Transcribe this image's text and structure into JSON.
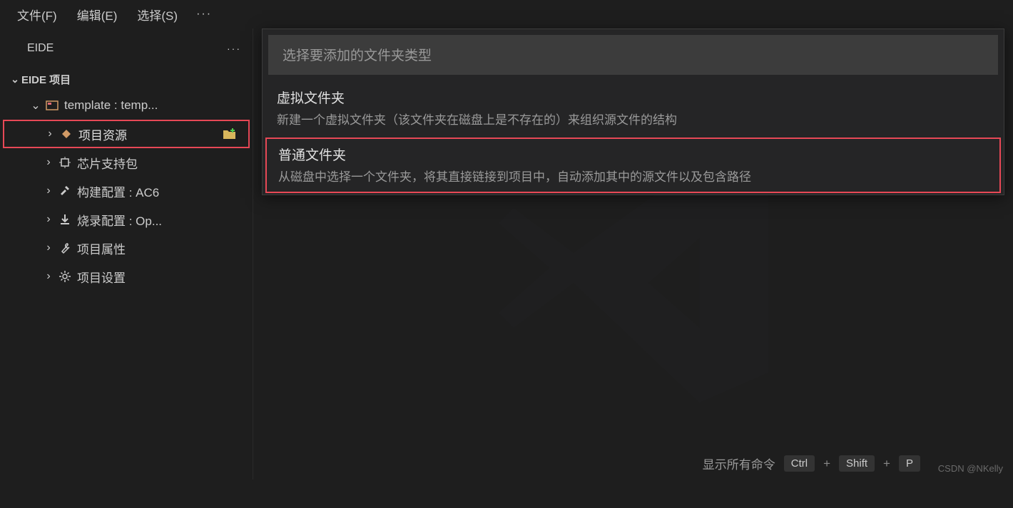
{
  "menubar": {
    "file": "文件(F)",
    "edit": "编辑(E)",
    "select": "选择(S)",
    "more": "···"
  },
  "sidebar": {
    "title": "EIDE",
    "more": "···",
    "section": "EIDE 项目",
    "project_name": "template : temp...",
    "items": [
      {
        "label": "项目资源",
        "name": "project-resources"
      },
      {
        "label": "芯片支持包",
        "name": "chip-support"
      },
      {
        "label": "构建配置 : AC6",
        "name": "build-config"
      },
      {
        "label": "烧录配置 : Op...",
        "name": "flash-config"
      },
      {
        "label": "项目属性",
        "name": "project-props"
      },
      {
        "label": "项目设置",
        "name": "project-settings"
      }
    ]
  },
  "quickpick": {
    "placeholder": "选择要添加的文件夹类型",
    "options": [
      {
        "title": "虚拟文件夹",
        "desc": "新建一个虚拟文件夹（该文件夹在磁盘上是不存在的）来组织源文件的结构"
      },
      {
        "title": "普通文件夹",
        "desc": "从磁盘中选择一个文件夹，将其直接链接到项目中，自动添加其中的源文件以及包含路径"
      }
    ]
  },
  "statusbar": {
    "hint": "显示所有命令",
    "keys": {
      "ctrl": "Ctrl",
      "shift": "Shift",
      "p": "P"
    }
  },
  "watermark": "CSDN @NKelly",
  "icons": {
    "chev_down": "⌄",
    "chev_right": "›"
  }
}
